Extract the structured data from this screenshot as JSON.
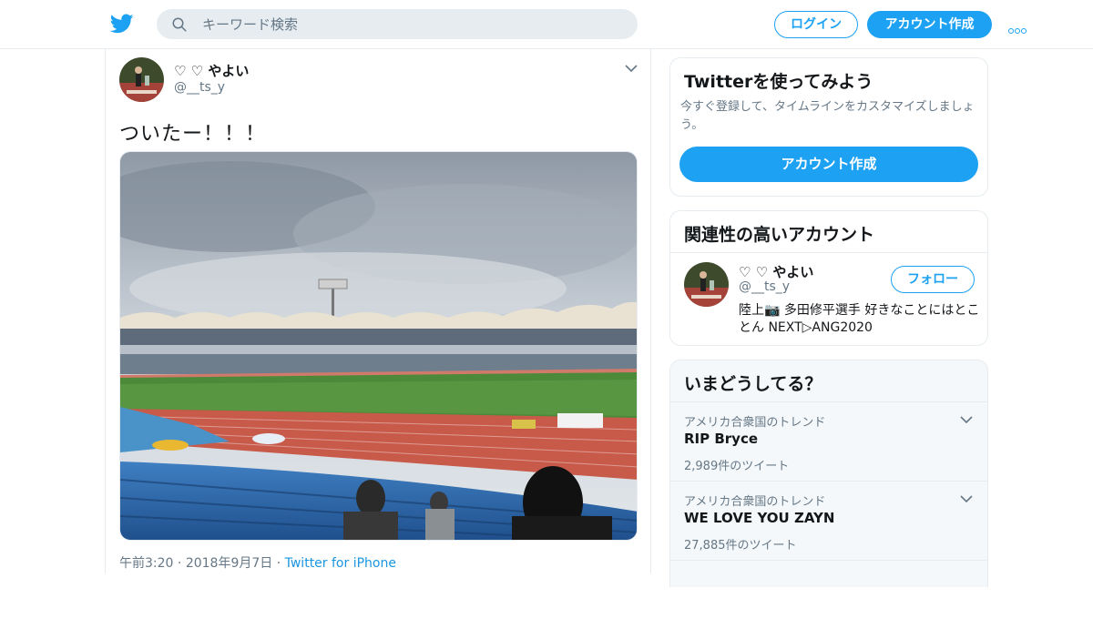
{
  "header": {
    "search_placeholder": "キーワード検索",
    "login_label": "ログイン",
    "signup_label": "アカウント作成"
  },
  "tweet": {
    "display_name": "♡ ♡ やよい",
    "handle": "@__ts_y",
    "text": "ついたー！！！",
    "time": "午前3:20",
    "date": "2018年9月7日",
    "source": "Twitter for iPhone"
  },
  "signup_card": {
    "title": "Twitterを使ってみよう",
    "description": "今すぐ登録して、タイムラインをカスタマイズしましょう。",
    "button_label": "アカウント作成"
  },
  "related_accounts": {
    "title": "関連性の高いアカウント",
    "items": [
      {
        "name": "♡ ♡ やよい",
        "handle": "@__ts_y",
        "follow_label": "フォロー",
        "bio": "陸上📷 多田修平選手 好きなことにはとことん NEXT▷ANG2020"
      }
    ]
  },
  "trends": {
    "title": "いまどうしてる？",
    "items": [
      {
        "context": "アメリカ合衆国のトレンド",
        "name": "RIP Bryce",
        "count": "2,989件のツイート"
      },
      {
        "context": "アメリカ合衆国のトレンド",
        "name": "WE LOVE YOU ZAYN",
        "count": "27,885件のツイート"
      }
    ]
  },
  "colors": {
    "brand": "#1da1f2",
    "muted": "#657786",
    "link": "#1b95e0"
  },
  "icons": [
    "twitter-bird-icon",
    "search-icon",
    "more-icon",
    "chevron-down-icon"
  ]
}
